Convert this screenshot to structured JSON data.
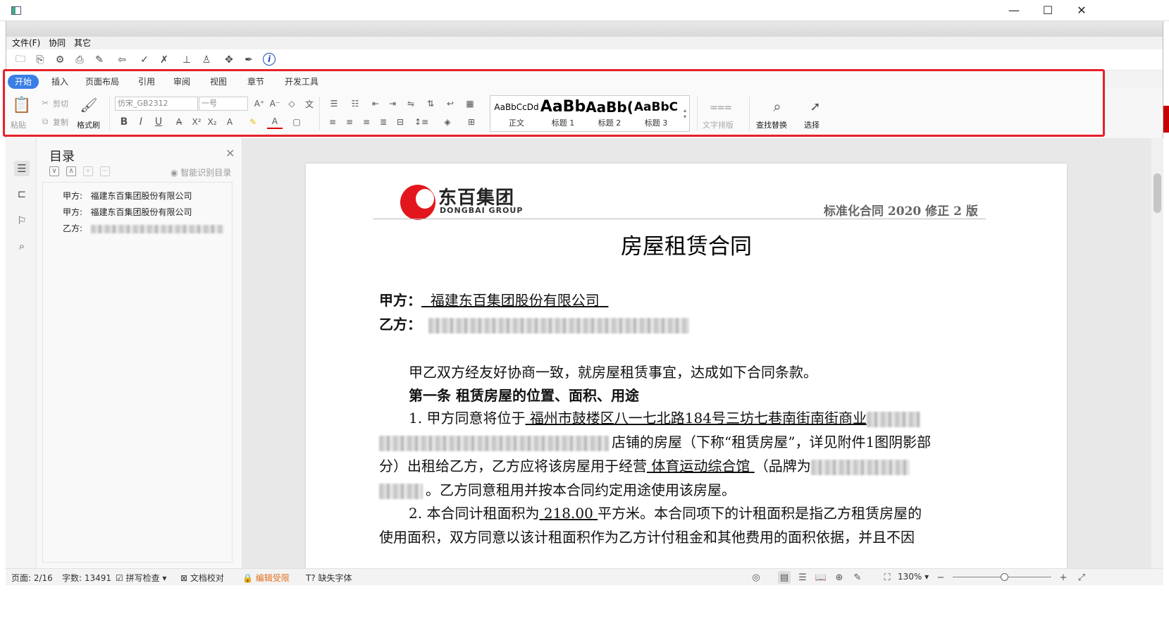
{
  "window": {
    "minimize": "—",
    "maximize": "☐",
    "close": "✕"
  },
  "menu": {
    "items": [
      "文件(F)",
      "协同",
      "其它"
    ]
  },
  "ribbon": {
    "tabs": [
      "开始",
      "插入",
      "页面布局",
      "引用",
      "审阅",
      "视图",
      "章节",
      "开发工具"
    ],
    "paste": "粘贴",
    "cut": "剪切",
    "copy": "复制",
    "format_painter": "格式刷",
    "font_name": "仿宋_GB2312",
    "font_size": "一号",
    "styles": [
      {
        "preview": "AaBbCcDd",
        "label": "正文"
      },
      {
        "preview": "AaBb",
        "label": "标题 1"
      },
      {
        "preview": "AaBb(",
        "label": "标题 2"
      },
      {
        "preview": "AaBbC",
        "label": "标题 3"
      }
    ],
    "text_layout": "文字排版",
    "find_replace": "查找替换",
    "select": "选择"
  },
  "toc": {
    "title": "目录",
    "smart": "智能识别目录",
    "items": [
      {
        "label": "甲方:",
        "value": "福建东百集团股份有限公司"
      },
      {
        "label": "甲方:",
        "value": "福建东百集团股份有限公司"
      },
      {
        "label": "乙方:",
        "value": ""
      }
    ]
  },
  "document": {
    "logo_cn": "东百集团",
    "logo_en": "DONGBAI GROUP",
    "header_right": "标准化合同 2020 修正 2 版",
    "title": "房屋租赁合同",
    "party_a_label": "甲方：",
    "party_a": "福建东百集团股份有限公司",
    "party_b_label": "乙方：",
    "intro": "甲乙双方经友好协商一致，就房屋租赁事宜，达成如下合同条款。",
    "article1": "第一条  租赁房屋的位置、面积、用途",
    "p1_start": "1. 甲方同意将位于",
    "p1_location": "福州市鼓楼区八一七北路184号三坊七巷南街南街商业",
    "p2_text": "店铺的房屋（下称“租赁房屋”，详见附件1图阴影部",
    "p3_start": "分）出租给乙方，乙方应将该房屋用于经营",
    "p3_use": "体育运动综合馆",
    "p3_end": "（品牌为",
    "p4_text": "。乙方同意租用并按本合同约定用途使用该房屋。",
    "p5_start": "2. 本合同计租面积为",
    "p5_area": "218.00",
    "p5_end": "平方米。本合同项下的计租面积是指乙方租赁房屋的",
    "p6_text": "使用面积，双方同意以该计租面积作为乙方计付租金和其他费用的面积依据，并且不因"
  },
  "status": {
    "page": "页面: 2/16",
    "words": "字数: 13491",
    "spell": "拼写检查",
    "proof": "文档校对",
    "restricted": "编辑受限",
    "missing_font": "缺失字体",
    "zoom": "130%"
  },
  "colors": {
    "accent": "#3a7ee6",
    "highlight": "#e8202a",
    "restricted": "#e07020"
  }
}
